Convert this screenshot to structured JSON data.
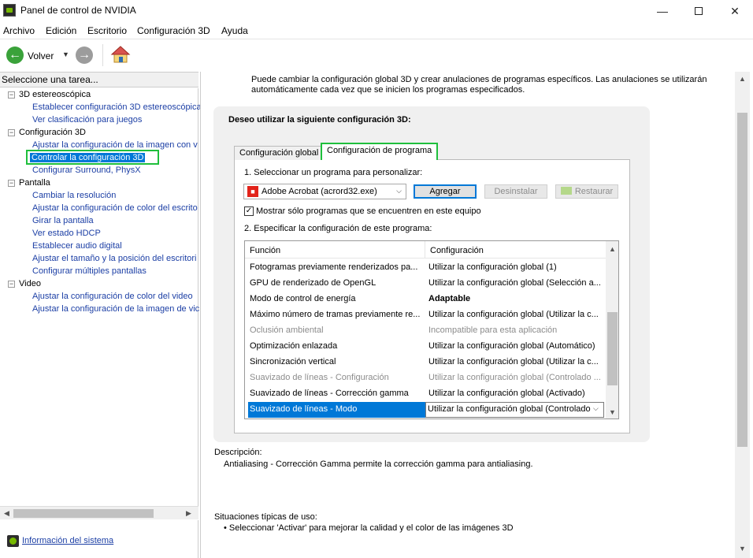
{
  "window": {
    "title": "Panel de control de NVIDIA",
    "min_glyph": "—",
    "close_glyph": "✕"
  },
  "menu": [
    "Archivo",
    "Edición",
    "Escritorio",
    "Configuración 3D",
    "Ayuda"
  ],
  "toolbar": {
    "back_label": "Volver",
    "back_icon": "arrow-left-icon",
    "forward_icon": "arrow-right-icon",
    "home_icon": "home-icon"
  },
  "left": {
    "header": "Seleccione una tarea...",
    "tree": [
      {
        "label": "3D estereoscópica",
        "type": "category"
      },
      {
        "label": "Establecer configuración 3D estereoscópica",
        "type": "link"
      },
      {
        "label": "Ver clasificación para juegos",
        "type": "link"
      },
      {
        "label": "Configuración 3D",
        "type": "category"
      },
      {
        "label": "Ajustar la configuración de la imagen con v",
        "type": "link"
      },
      {
        "label": "Controlar la configuración 3D",
        "type": "link",
        "selected": true
      },
      {
        "label": "Configurar Surround, PhysX",
        "type": "link"
      },
      {
        "label": "Pantalla",
        "type": "category"
      },
      {
        "label": "Cambiar la resolución",
        "type": "link"
      },
      {
        "label": "Ajustar la configuración de color del escrito",
        "type": "link"
      },
      {
        "label": "Girar la pantalla",
        "type": "link"
      },
      {
        "label": "Ver estado HDCP",
        "type": "link"
      },
      {
        "label": "Establecer audio digital",
        "type": "link"
      },
      {
        "label": "Ajustar el tamaño y la posición del escritori",
        "type": "link"
      },
      {
        "label": "Configurar múltiples pantallas",
        "type": "link"
      },
      {
        "label": "Video",
        "type": "category"
      },
      {
        "label": "Ajustar la configuración de color del video",
        "type": "link"
      },
      {
        "label": "Ajustar la configuración de la imagen de vic",
        "type": "link"
      }
    ],
    "info_link": "Información del sistema"
  },
  "main": {
    "intro": "Puede cambiar la configuración global 3D y crear anulaciones de programas específicos. Las anulaciones se utilizarán automáticamente cada vez que se inicien los programas especificados.",
    "heading": "Deseo utilizar la siguiente configuración 3D:",
    "tabs": [
      "Configuración global",
      "Configuración de programa"
    ],
    "step1": "1. Seleccionar un programa para personalizar:",
    "program": "Adobe Acrobat (acrord32.exe)",
    "add_button": "Agregar",
    "uninstall_button": "Desinstalar",
    "restore_button": "Restaurar",
    "checkbox_label": "Mostrar sólo programas que se encuentren en este equipo",
    "checkbox_checked": true,
    "step2": "2. Especificar la configuración de este programa:",
    "table": {
      "headers": [
        "Función",
        "Configuración"
      ],
      "rows": [
        {
          "func": "Fotogramas previamente renderizados pa...",
          "conf": "Utilizar la configuración global (1)",
          "state": "normal"
        },
        {
          "func": "GPU de renderizado de OpenGL",
          "conf": "Utilizar la configuración global (Selección a...",
          "state": "normal"
        },
        {
          "func": "Modo de control de energía",
          "conf": "Adaptable",
          "state": "bold"
        },
        {
          "func": "Máximo número de tramas previamente re...",
          "conf": "Utilizar la configuración global (Utilizar la c...",
          "state": "normal"
        },
        {
          "func": "Oclusión ambiental",
          "conf": "Incompatible para esta aplicación",
          "state": "disabled"
        },
        {
          "func": "Optimización enlazada",
          "conf": "Utilizar la configuración global (Automático)",
          "state": "normal"
        },
        {
          "func": "Sincronización vertical",
          "conf": "Utilizar la configuración global (Utilizar la c...",
          "state": "normal"
        },
        {
          "func": "Suavizado de líneas - Configuración",
          "conf": "Utilizar la configuración global (Controlado ...",
          "state": "disabled"
        },
        {
          "func": "Suavizado de líneas - Corrección gamma",
          "conf": "Utilizar la configuración global (Activado)",
          "state": "normal"
        },
        {
          "func": "Suavizado de líneas - Modo",
          "conf": "Utilizar la configuración global (Controlado",
          "state": "selected"
        }
      ]
    },
    "description_title": "Descripción:",
    "description_text": "Antialiasing - Corrección Gamma permite la corrección gamma para antialiasing.",
    "usage_title": "Situaciones típicas de uso:",
    "usage_text": "• Seleccionar 'Activar' para mejorar la calidad y el color de las imágenes 3D"
  },
  "colors": {
    "accent_green": "#1fbf3c",
    "selection_blue": "#0078d7",
    "link_blue": "#1c3fa5",
    "nvidia_green": "#76b900"
  }
}
